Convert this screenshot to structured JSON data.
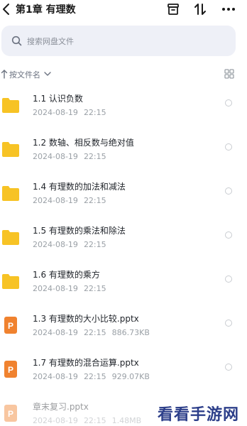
{
  "header": {
    "title": "第1章 有理数",
    "icons": [
      "back-icon",
      "archive-icon",
      "sort-icon",
      "more-icon"
    ]
  },
  "search": {
    "placeholder": "搜索网盘文件"
  },
  "sort": {
    "label": "按文件名",
    "direction": "ascending"
  },
  "files": [
    {
      "name": "1.1 认识负数",
      "date": "2024-08-19",
      "time": "22:15",
      "size": "",
      "type": "folder"
    },
    {
      "name": "1.2 数轴、相反数与绝对值",
      "date": "2024-08-19",
      "time": "22:15",
      "size": "",
      "type": "folder"
    },
    {
      "name": "1.4 有理数的加法和减法",
      "date": "2024-08-19",
      "time": "22:15",
      "size": "",
      "type": "folder"
    },
    {
      "name": "1.5 有理数的乘法和除法",
      "date": "2024-08-19",
      "time": "22:15",
      "size": "",
      "type": "folder"
    },
    {
      "name": "1.6 有理数的乘方",
      "date": "2024-08-19",
      "time": "22:15",
      "size": "",
      "type": "folder"
    },
    {
      "name": "1.3 有理数的大小比较.pptx",
      "date": "2024-08-19",
      "time": "22:15",
      "size": "886.73KB",
      "type": "pptx"
    },
    {
      "name": "1.7 有理数的混合运算.pptx",
      "date": "2024-08-19",
      "time": "22:15",
      "size": "929.07KB",
      "type": "pptx"
    },
    {
      "name": "章末复习.pptx",
      "date": "2024-08-19",
      "time": "22:15",
      "size": "1.48MB",
      "type": "pptx"
    }
  ],
  "colors": {
    "folder": "#f7c325",
    "pptx": "#f0822f",
    "search_bg": "#eef0f7"
  },
  "watermark": "看看手游网"
}
